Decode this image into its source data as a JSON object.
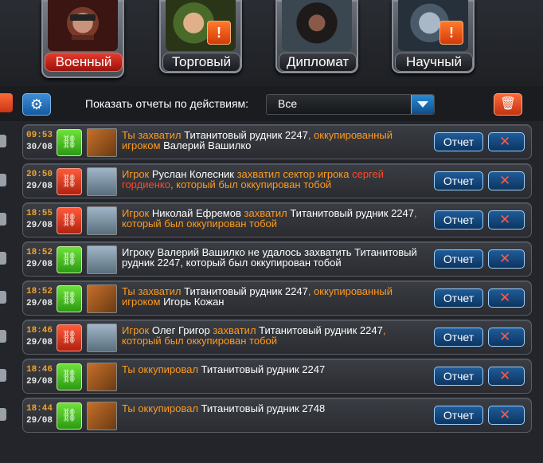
{
  "advisors": [
    {
      "label": "Военный",
      "active": true,
      "alert": false,
      "icon": "military-advisor-portrait"
    },
    {
      "label": "Торговый",
      "active": false,
      "alert": true,
      "icon": "trade-advisor-portrait"
    },
    {
      "label": "Дипломат",
      "active": false,
      "alert": false,
      "icon": "diplomat-advisor-portrait"
    },
    {
      "label": "Научный",
      "active": false,
      "alert": true,
      "icon": "science-advisor-portrait"
    }
  ],
  "alert_glyph": "!",
  "toolbar": {
    "filter_label": "Показать отчеты по действиям:",
    "filter_value": "Все",
    "gear_glyph": "⚙",
    "trash_glyph": "🗑"
  },
  "buttons": {
    "report_label": "Отчет",
    "delete_glyph": "✕"
  },
  "status_glyph": "⛓",
  "events": [
    {
      "time": "09:53",
      "date": "30/08",
      "status": "green",
      "thumb": "mine",
      "msg": [
        {
          "t": "Ты захватил ",
          "c": "o"
        },
        {
          "t": "Титанитовый рудник 2247",
          "c": "w"
        },
        {
          "t": ", оккупированный игроком ",
          "c": "o"
        },
        {
          "t": "Валерий Вашилко",
          "c": "w"
        }
      ]
    },
    {
      "time": "20:50",
      "date": "29/08",
      "status": "red",
      "thumb": "player",
      "msg": [
        {
          "t": "Игрок ",
          "c": "o"
        },
        {
          "t": "Руслан Колесник",
          "c": "w"
        },
        {
          "t": " захватил сектор игрока ",
          "c": "o"
        },
        {
          "t": "сергей гордиенко",
          "c": "r"
        },
        {
          "t": ", который был оккупирован тобой",
          "c": "o"
        }
      ]
    },
    {
      "time": "18:55",
      "date": "29/08",
      "status": "red",
      "thumb": "player",
      "msg": [
        {
          "t": "Игрок ",
          "c": "o"
        },
        {
          "t": "Николай Ефремов",
          "c": "w"
        },
        {
          "t": " захватил ",
          "c": "o"
        },
        {
          "t": "Титанитовый рудник 2247",
          "c": "w"
        },
        {
          "t": ", который был оккупирован тобой",
          "c": "o"
        }
      ]
    },
    {
      "time": "18:52",
      "date": "29/08",
      "status": "green",
      "thumb": "player",
      "msg": [
        {
          "t": "Игроку Валерий Вашилко не удалось захватить Титанитовый рудник 2247, который был оккупирован тобой",
          "c": "w"
        }
      ]
    },
    {
      "time": "18:52",
      "date": "29/08",
      "status": "green",
      "thumb": "mine",
      "msg": [
        {
          "t": "Ты захватил ",
          "c": "o"
        },
        {
          "t": "Титанитовый рудник 2247",
          "c": "w"
        },
        {
          "t": ", оккупированный игроком ",
          "c": "o"
        },
        {
          "t": "Игорь Кожан",
          "c": "w"
        }
      ]
    },
    {
      "time": "18:46",
      "date": "29/08",
      "status": "red",
      "thumb": "player",
      "msg": [
        {
          "t": "Игрок ",
          "c": "o"
        },
        {
          "t": "Олег Григор",
          "c": "w"
        },
        {
          "t": " захватил ",
          "c": "o"
        },
        {
          "t": "Титанитовый рудник 2247",
          "c": "w"
        },
        {
          "t": ", который был оккупирован тобой",
          "c": "o"
        }
      ]
    },
    {
      "time": "18:46",
      "date": "29/08",
      "status": "green",
      "thumb": "mine",
      "msg": [
        {
          "t": "Ты оккупировал ",
          "c": "o"
        },
        {
          "t": "Титанитовый рудник 2247",
          "c": "w"
        }
      ]
    },
    {
      "time": "18:44",
      "date": "29/08",
      "status": "green",
      "thumb": "mine",
      "msg": [
        {
          "t": "Ты оккупировал ",
          "c": "o"
        },
        {
          "t": "Титанитовый рудник 2748",
          "c": "w"
        }
      ]
    }
  ]
}
